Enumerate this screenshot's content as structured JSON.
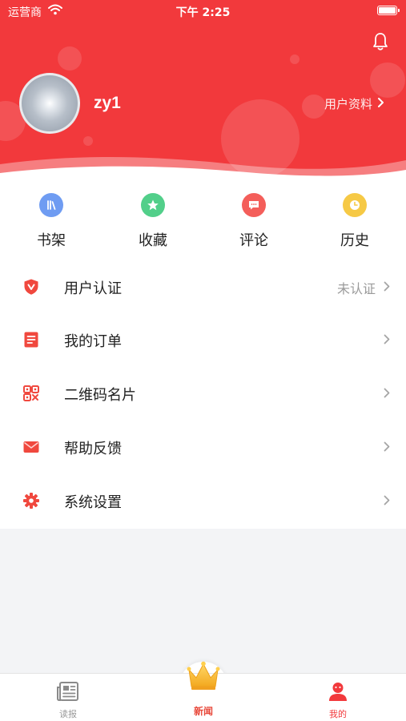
{
  "status_bar": {
    "carrier": "运营商",
    "time": "下午 2:25"
  },
  "profile": {
    "username": "zy1",
    "profile_link": "用户资料"
  },
  "quick_actions": [
    {
      "label": "书架",
      "icon": "bookshelf-icon",
      "color": "#6f9cf2"
    },
    {
      "label": "收藏",
      "icon": "star-icon",
      "color": "#52cf8a"
    },
    {
      "label": "评论",
      "icon": "comment-icon",
      "color": "#f45e5a"
    },
    {
      "label": "历史",
      "icon": "clock-icon",
      "color": "#f6c945"
    }
  ],
  "menu": [
    {
      "label": "用户认证",
      "value": "未认证",
      "icon": "shield-v-icon"
    },
    {
      "label": "我的订单",
      "value": "",
      "icon": "document-icon"
    },
    {
      "label": "二维码名片",
      "value": "",
      "icon": "qr-code-icon"
    },
    {
      "label": "帮助反馈",
      "value": "",
      "icon": "envelope-icon"
    },
    {
      "label": "系统设置",
      "value": "",
      "icon": "gear-icon"
    }
  ],
  "tabbar": {
    "items": [
      {
        "label": "读报",
        "icon": "newspaper-icon",
        "active": false
      },
      {
        "label": "新闻",
        "icon": "crown-icon",
        "active": false
      },
      {
        "label": "我的",
        "icon": "person-icon",
        "active": true
      }
    ]
  },
  "colors": {
    "accent": "#f2393c",
    "tab_active": "#f2393c",
    "tab_inactive": "#9a9a9a"
  }
}
